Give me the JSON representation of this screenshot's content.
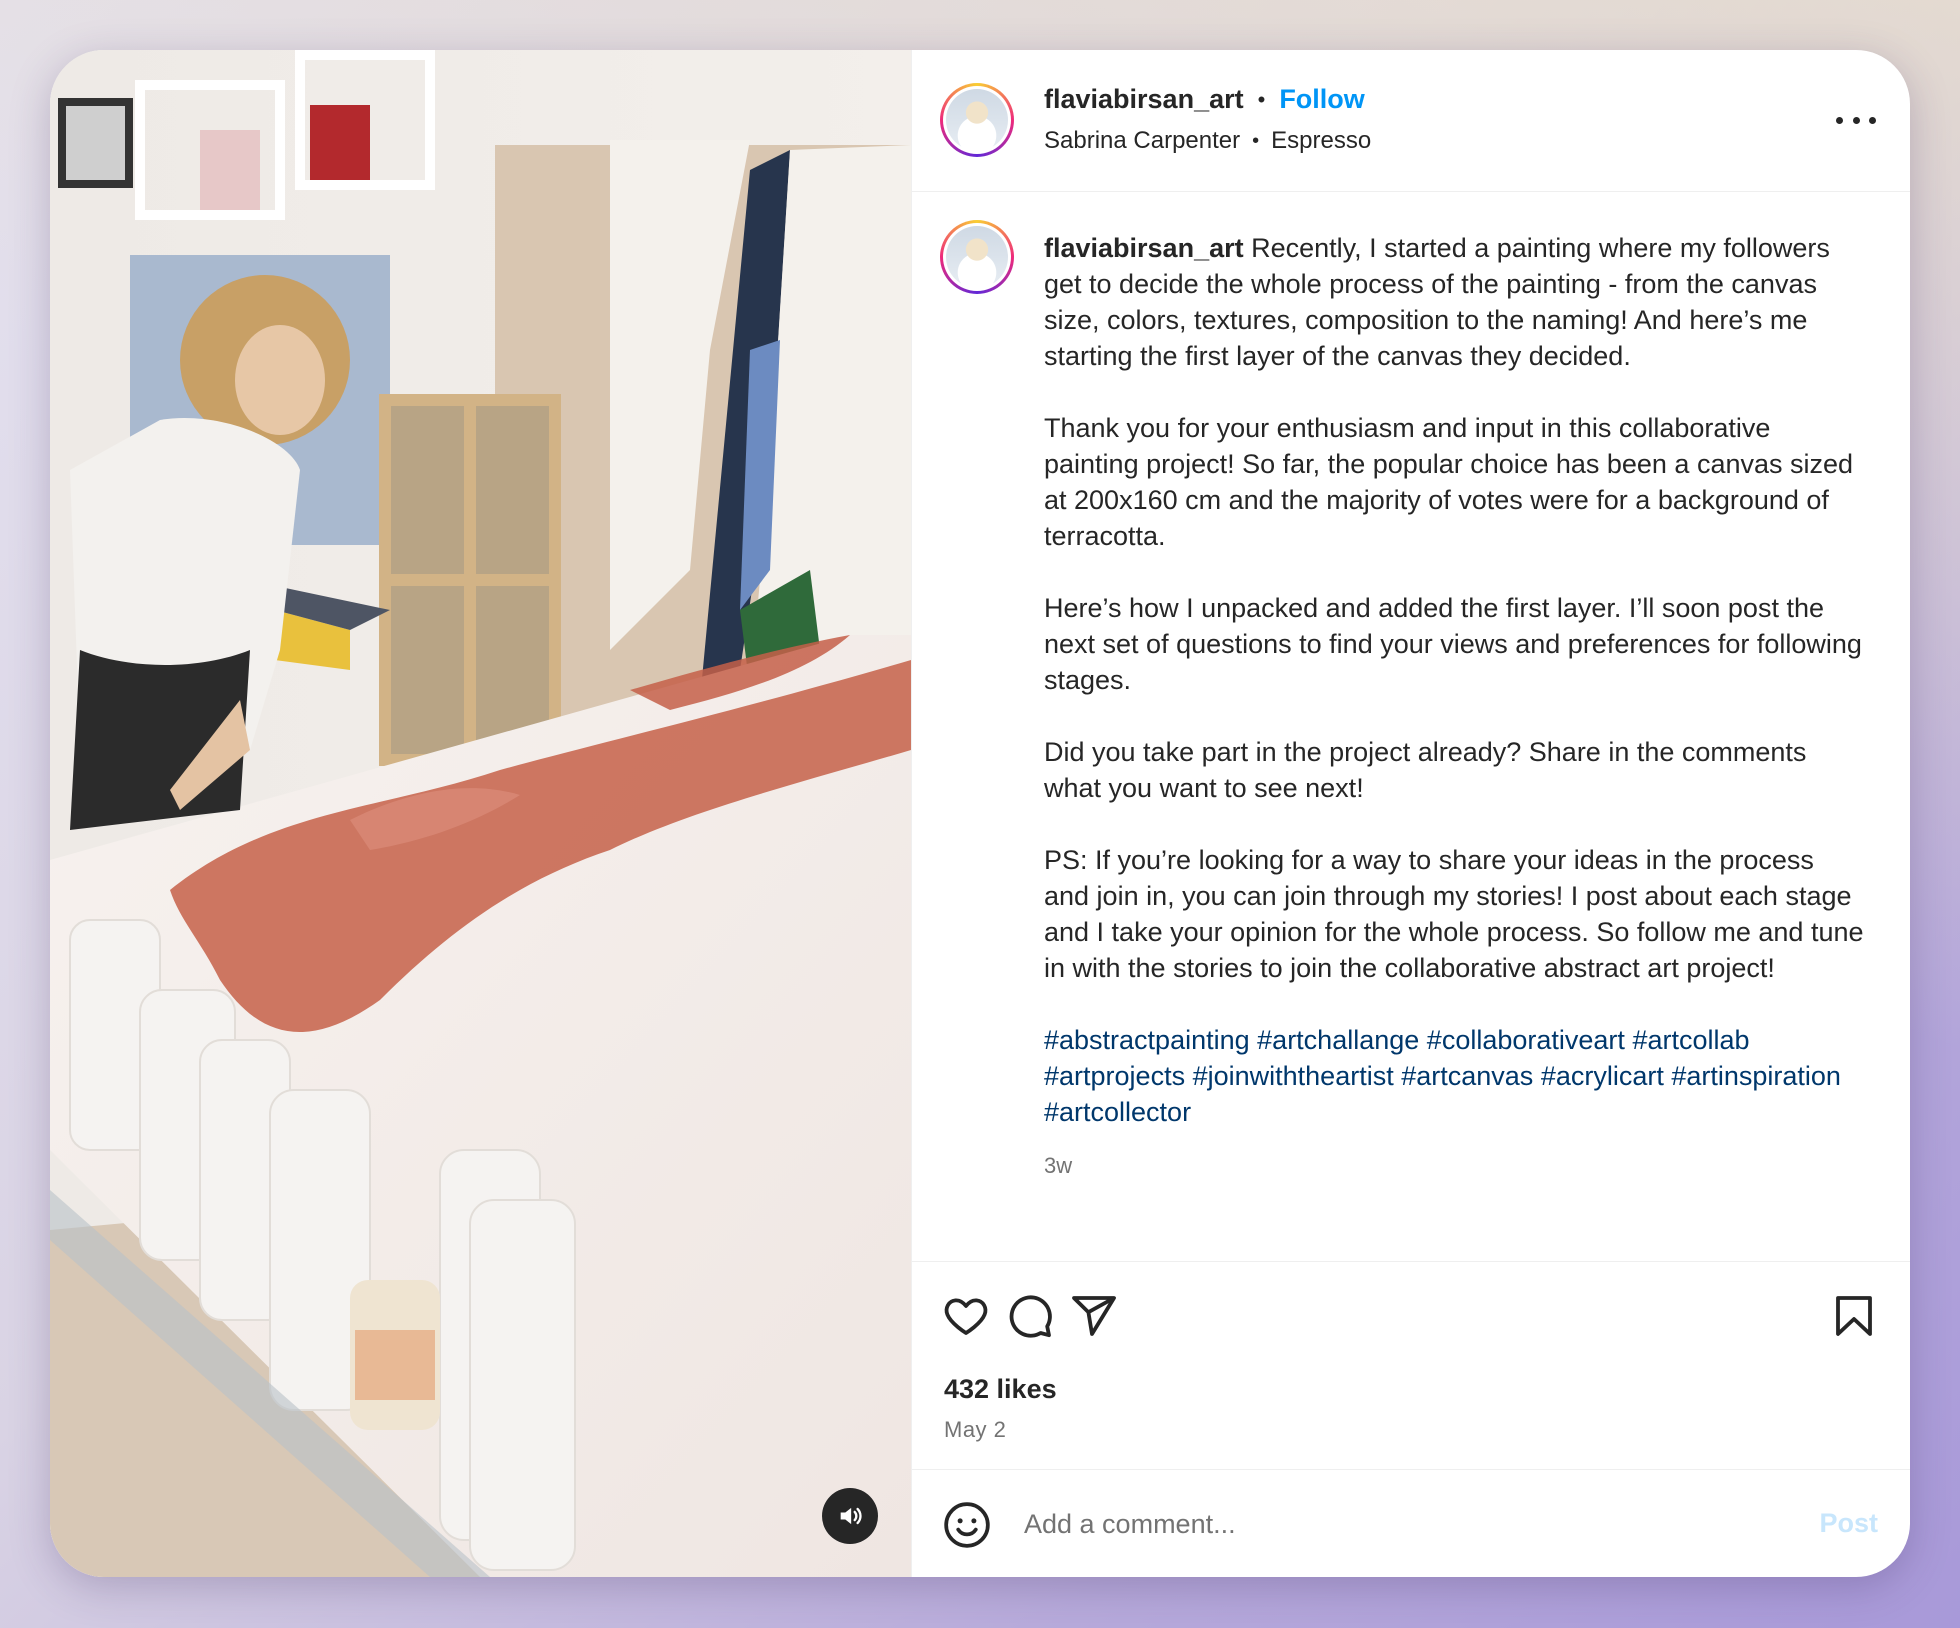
{
  "post": {
    "username": "flaviabirsan_art",
    "separator": "•",
    "follow_label": "Follow",
    "audio_artist": "Sabrina Carpenter",
    "audio_track": "Espresso",
    "caption_username": "flaviabirsan_art",
    "caption_paragraphs": [
      "Recently, I started a painting where my followers get to decide the whole process of the painting - from the canvas size, colors, textures, composition to the naming! And here’s me starting the first layer of the canvas they decided.",
      "Thank you for your enthusiasm and input in this collaborative painting project! So far, the popular choice has been a canvas sized at 200x160 cm and the majority of votes were for a background of terracotta.",
      "Here’s how I unpacked and added the first layer. I’ll soon post the next set of questions to find your views and preferences for following stages.",
      "Did you take part in the project already? Share in the comments what you want to see next!",
      "PS: If you’re looking for a way to share your ideas in the process and join in, you can join through my stories! I post about each stage and I take your opinion for the whole process. So follow me and tune in with the stories to join the collaborative abstract art project!"
    ],
    "hashtags": [
      "#abstractpainting",
      "#artchallange",
      "#collaborativeart",
      "#artcollab",
      "#artprojects",
      "#joinwiththeartist",
      "#artcanvas",
      "#acrylicart",
      "#artinspiration",
      "#artcollector"
    ],
    "time_ago": "3w",
    "likes": "432 likes",
    "date": "May 2"
  },
  "actions": {
    "like_icon": "heart-icon",
    "comment_icon": "comment-bubble-icon",
    "share_icon": "paper-plane-icon",
    "save_icon": "bookmark-icon"
  },
  "comment": {
    "placeholder": "Add a comment...",
    "post_label": "Post"
  },
  "colors": {
    "follow": "#0095f6",
    "hashtag": "#00376b",
    "post_disabled": "#c8e6fc",
    "terracotta": "#c96b55"
  }
}
